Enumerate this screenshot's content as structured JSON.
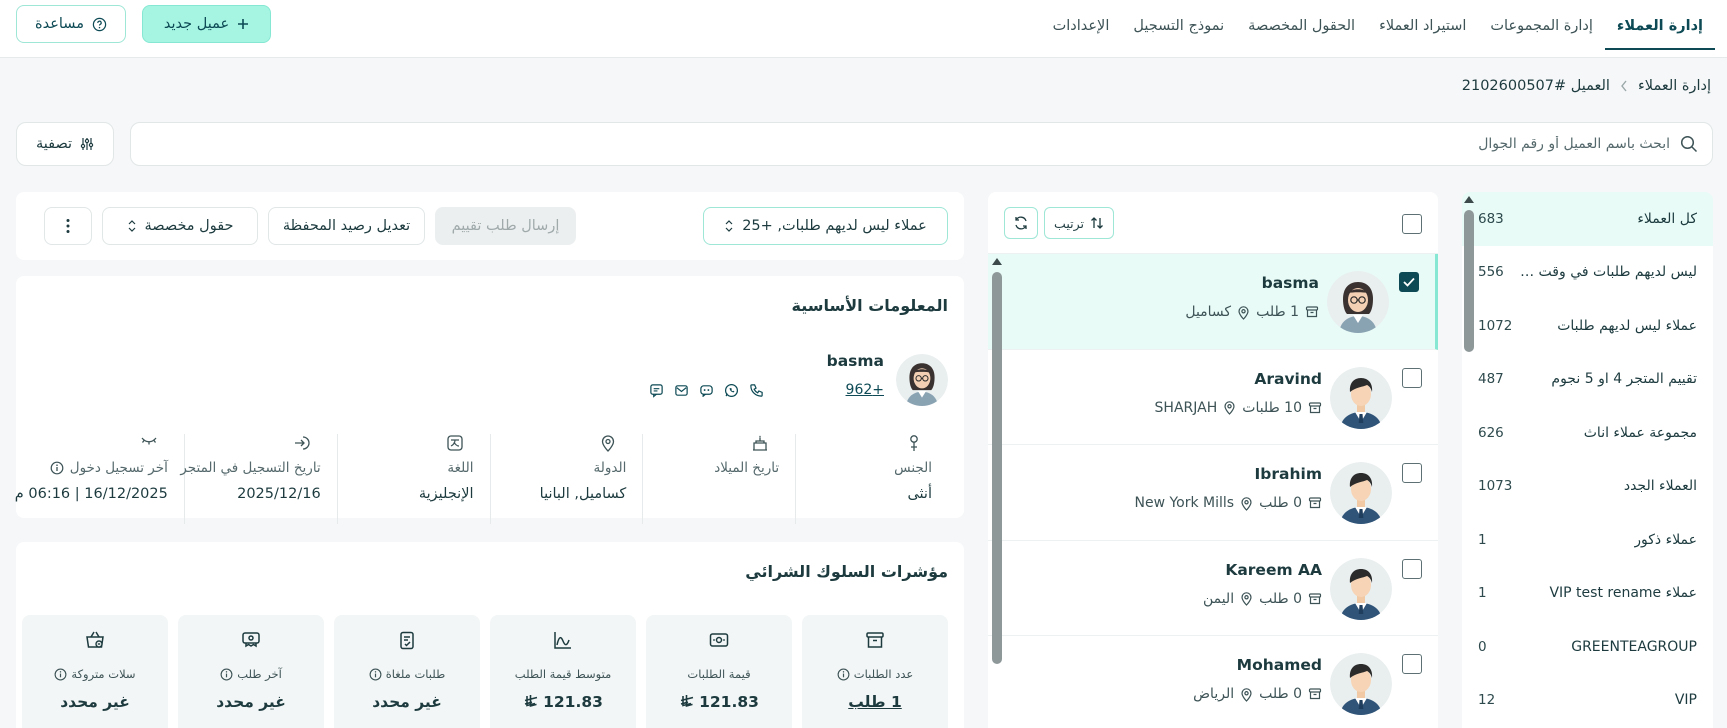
{
  "topnav": {
    "items": [
      {
        "label": "إدارة العملاء",
        "active": true
      },
      {
        "label": "إدارة المجموعات"
      },
      {
        "label": "استيراد العملاء"
      },
      {
        "label": "الحقول المخصصة"
      },
      {
        "label": "نموذج التسجيل"
      },
      {
        "label": "الإعدادات"
      }
    ],
    "new_customer": "عميل جديد",
    "help": "مساعدة"
  },
  "breadcrumb": {
    "root": "إدارة العملاء",
    "current": "العميل #2102600507"
  },
  "search": {
    "placeholder": "ابحث باسم العميل أو رقم الجوال",
    "filter_label": "تصفية"
  },
  "groups": [
    {
      "name": "كل العملاء",
      "count": "683"
    },
    {
      "name": "ليس لديهم طلبات في وقت محدد",
      "count": "556"
    },
    {
      "name": "عملاء ليس لديهم طلبات",
      "count": "1072"
    },
    {
      "name": "تقييم المتجر 4 او 5 نجوم",
      "count": "487"
    },
    {
      "name": "مجموعة عملاء اناث",
      "count": "626"
    },
    {
      "name": "العملاء الجدد",
      "count": "1073"
    },
    {
      "name": "عملاء ذكور",
      "count": "1"
    },
    {
      "name": "عملاء VIP test rename",
      "count": "1"
    },
    {
      "name": "GREENTEAGROUP",
      "count": "0"
    },
    {
      "name": "VIP",
      "count": "12"
    }
  ],
  "customer_list": {
    "sort_label": "ترتيب",
    "items": [
      {
        "name": "basma",
        "orders": "1 طلب",
        "location": "كساميل",
        "checked": true,
        "gender": "female"
      },
      {
        "name": "Aravind",
        "orders": "10 طلبات",
        "location": "SHARJAH",
        "checked": false,
        "gender": "male"
      },
      {
        "name": "Ibrahim",
        "orders": "0 طلب",
        "location": "New York Mills",
        "checked": false,
        "gender": "male"
      },
      {
        "name": "Kareem AA",
        "orders": "0 طلب",
        "location": "اليمن",
        "checked": false,
        "gender": "male"
      },
      {
        "name": "Mohamed",
        "orders": "0 طلب",
        "location": "الرياض",
        "checked": false,
        "gender": "male"
      }
    ]
  },
  "actions": {
    "group_select": "عملاء ليس لديهم طلبات, +25",
    "send_rating": "إرسال طلب تقييم",
    "edit_wallet": "تعديل رصيد المحفظة",
    "custom_fields": "حقول مخصصة"
  },
  "basic_info": {
    "title": "المعلومات الأساسية",
    "name": "basma",
    "phone": "+962",
    "fields": [
      {
        "label": "الجنس",
        "value": "أنثى",
        "icon": "gender-icon"
      },
      {
        "label": "تاريخ الميلاد",
        "value": "",
        "icon": "cake-icon"
      },
      {
        "label": "الدولة",
        "value": "كساميل, البانيا",
        "icon": "location-pin-icon"
      },
      {
        "label": "اللغة",
        "value": "الإنجليزية",
        "icon": "language-icon"
      },
      {
        "label": "تاريخ التسجيل في المتجر",
        "value": "2025/12/16",
        "icon": "sign-in-icon"
      },
      {
        "label": "آخر تسجيل دخول",
        "value": "16/12/2025 | 06:16 م",
        "icon": "eye-closed-icon"
      }
    ]
  },
  "behavior": {
    "title": "مؤشرات السلوك الشرائي",
    "kpis": [
      {
        "label": "عدد الطلبات",
        "value": "1 طلب",
        "info": true,
        "currency": false,
        "link": true
      },
      {
        "label": "قيمة الطلبات",
        "value": "121.83",
        "info": false,
        "currency": true
      },
      {
        "label": "متوسط قيمة الطلب",
        "value": "121.83",
        "info": false,
        "currency": true
      },
      {
        "label": "طلبات ملغاة",
        "value": "غير محدد",
        "info": true,
        "currency": false
      },
      {
        "label": "آخر طلب",
        "value": "غير محدد",
        "info": true,
        "currency": false
      },
      {
        "label": "سلات متروكة",
        "value": "غير محدد",
        "info": true,
        "currency": false
      }
    ]
  },
  "colors": {
    "primary": "#0d4a55",
    "accent": "#a6f5e3",
    "active_row": "#e8fbf7"
  }
}
